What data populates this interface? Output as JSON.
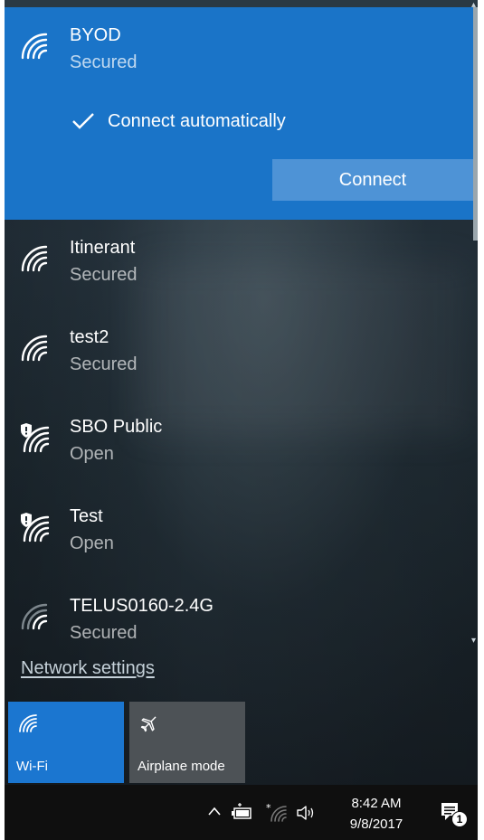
{
  "networks": [
    {
      "name": "BYOD",
      "status": "Secured",
      "selected": true,
      "icon": "wifi-secured-icon"
    },
    {
      "name": "Itinerant",
      "status": "Secured",
      "icon": "wifi-secured-icon"
    },
    {
      "name": "test2",
      "status": "Secured",
      "icon": "wifi-secured-icon"
    },
    {
      "name": "SBO Public",
      "status": "Open",
      "icon": "wifi-open-shield-icon"
    },
    {
      "name": "Test",
      "status": "Open",
      "icon": "wifi-open-shield-icon"
    },
    {
      "name": "TELUS0160-2.4G",
      "status": "Secured",
      "icon": "wifi-weak-icon"
    }
  ],
  "selected_network": {
    "auto_connect_label": "Connect automatically",
    "auto_connect_checked": true,
    "connect_button_label": "Connect"
  },
  "network_settings_label": "Network settings",
  "quick_actions": [
    {
      "label": "Wi-Fi",
      "active": true,
      "icon": "wifi-icon"
    },
    {
      "label": "Airplane mode",
      "active": false,
      "icon": "airplane-icon"
    }
  ],
  "taskbar": {
    "time": "8:42 AM",
    "date": "9/8/2017",
    "notification_count": "1",
    "tray_icons": [
      "chevron-up-icon",
      "battery-icon",
      "wifi-tray-icon",
      "volume-icon"
    ]
  },
  "colors": {
    "accent": "#1a74c8",
    "connect_button": "#4e93d6",
    "tile_active": "#1b76d0",
    "tile_inactive": "#4d5256",
    "taskbar": "#0f0f0f"
  }
}
